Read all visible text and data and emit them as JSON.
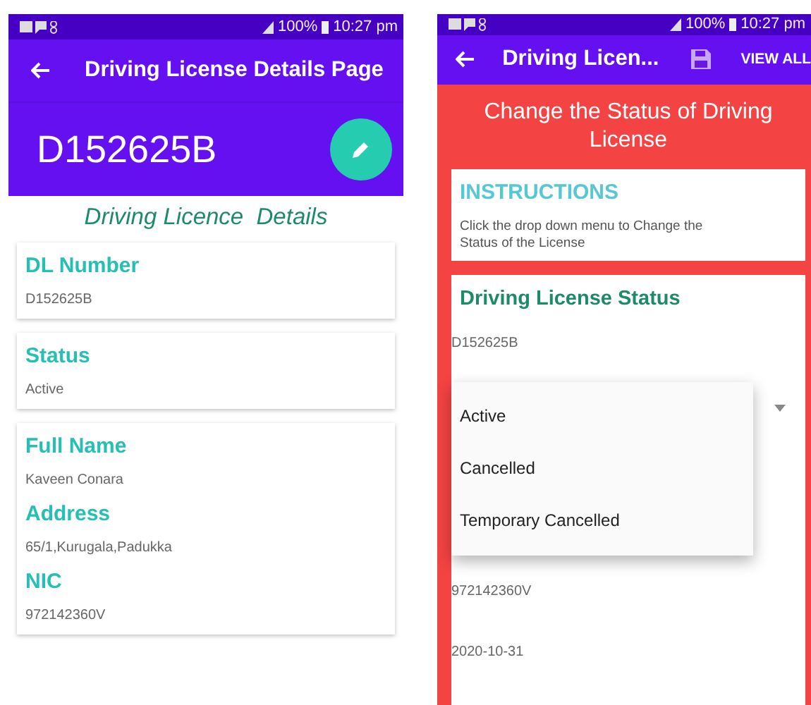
{
  "details_screen": {
    "status_bar": {
      "battery": "100%",
      "time": "10:27 pm"
    },
    "app_bar": {
      "title": "Driving License Details Page"
    },
    "header": {
      "license_number": "D152625B"
    },
    "section_title": "Driving Licence  Details",
    "cards": [
      {
        "fields": [
          {
            "label": "DL Number",
            "value": "D152625B"
          }
        ]
      },
      {
        "fields": [
          {
            "label": "Status",
            "value": "Active"
          }
        ]
      },
      {
        "fields": [
          {
            "label": "Full Name",
            "value": "Kaveen Conara"
          },
          {
            "label": "Address",
            "value": "65/1,Kurugala,Padukka"
          },
          {
            "label": "NIC",
            "value": "972142360V"
          }
        ]
      }
    ]
  },
  "status_screen": {
    "status_bar": {
      "battery": "100%",
      "time": "10:27 pm"
    },
    "app_bar": {
      "title": "Driving Licen...",
      "action": "VIEW ALL"
    },
    "heading": "Change the Status of Driving License",
    "instructions": {
      "title": "INSTRUCTIONS",
      "text": "Click the drop down menu to Change the Status of the License"
    },
    "status_card": {
      "title": "Driving License Status",
      "license_number": "D152625B",
      "dropdown_options": [
        "Active",
        "Cancelled",
        "Temporary Cancelled"
      ],
      "lines": [
        "972142360V",
        "2020-10-31"
      ]
    }
  }
}
